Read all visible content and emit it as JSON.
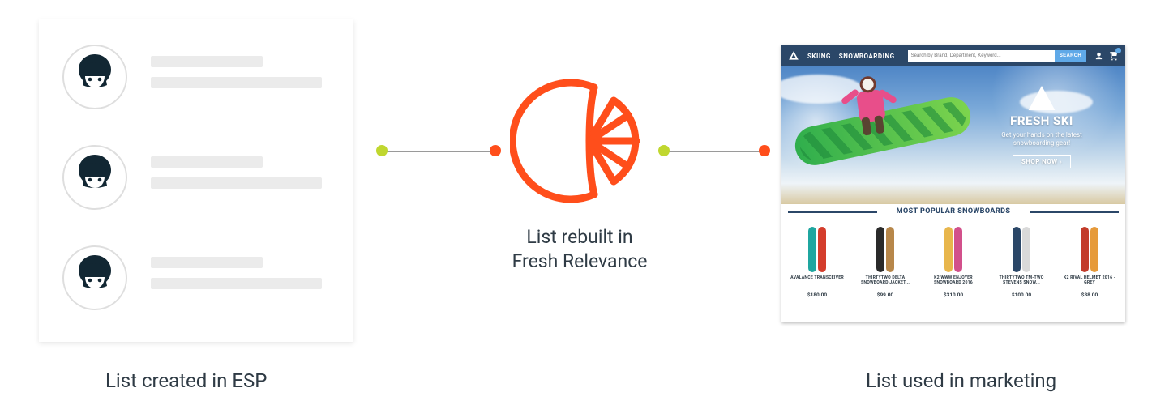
{
  "diagram": {
    "left_caption": "List created in ESP",
    "center_caption_line1": "List rebuilt in",
    "center_caption_line2": "Fresh Relevance",
    "right_caption": "List used in marketing"
  },
  "connector_colors": {
    "start_dot": "#c0d72f",
    "end_dot": "#ff4e1b",
    "line": "#9a9a9a"
  },
  "fresh_relevance_logo_color": "#ff4e1b",
  "esp_panel": {
    "rows": 3
  },
  "site": {
    "topnav": {
      "items": [
        "SKIING",
        "SNOWBOARDING"
      ],
      "search_placeholder": "Search by Brand, Department, Keyword...",
      "search_button": "SEARCH"
    },
    "hero": {
      "brand": "FRESH SKI",
      "tagline": "Get your hands on the latest snowboarding gear!",
      "cta": "SHOP NOW"
    },
    "products_heading": "MOST POPULAR SNOWBOARDS",
    "products": [
      {
        "name": "AVALANCE TRANSCEIVER",
        "price": "$180.00",
        "boards": [
          "#1fa6a0",
          "#d43d2c"
        ]
      },
      {
        "name": "THIRTYTWO DELTA SNOWBOARD JACKET...",
        "price": "$99.00",
        "boards": [
          "#2a2a2a",
          "#b7874a"
        ]
      },
      {
        "name": "K2 WWW ENJOYER SNOWBOARD 2016",
        "price": "$310.00",
        "boards": [
          "#e8b64c",
          "#d2508b"
        ]
      },
      {
        "name": "THIRTYTWO TM-TWO STEVENS SNOW...",
        "price": "$100.00",
        "boards": [
          "#2b4768",
          "#d9d9d9"
        ]
      },
      {
        "name": "K2 RIVAL HELMET 2016 - GREY",
        "price": "$38.00",
        "boards": [
          "#c23b2a",
          "#e69a3a"
        ]
      }
    ]
  }
}
